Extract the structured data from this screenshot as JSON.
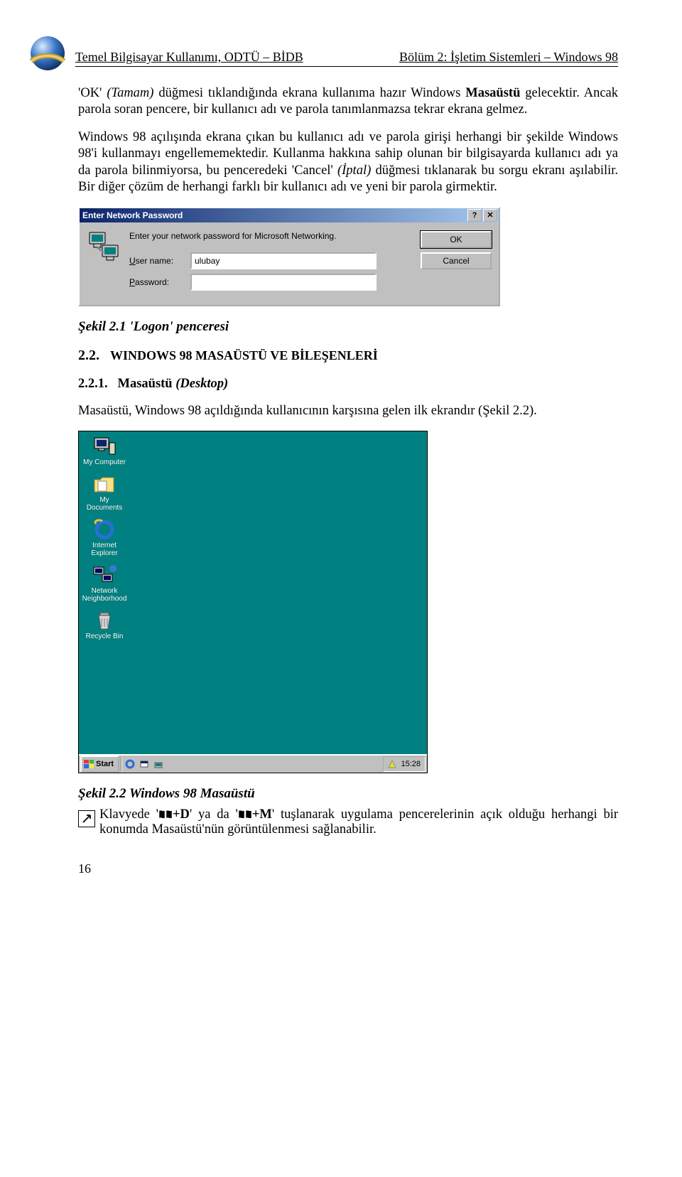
{
  "header": {
    "left": "Temel Bilgisayar Kullanımı, ODTÜ – BİDB",
    "right": "Bölüm 2: İşletim Sistemleri – Windows 98"
  },
  "para1_pre": "'OK' ",
  "para1_tamam": "(Tamam)",
  "para1_mid": " düğmesi tıklandığında ekrana kullanıma hazır Windows ",
  "para1_masaustu": "Masaüstü",
  "para1_post": " gelecektir. Ancak parola soran pencere, bir kullanıcı adı ve parola tanımlanmazsa tekrar ekrana gelmez.",
  "para2_a": "Windows 98 açılışında ekrana çıkan bu kullanıcı adı ve parola girişi herhangi bir şekilde Windows 98'i kullanmayı engellememektedir. Kullanma hakkına sahip olunan bir bilgisayarda kullanıcı adı ya da parola bilinmiyorsa, bu penceredeki 'Cancel' ",
  "para2_iptal": "(İptal)",
  "para2_b": " düğmesi tıklanarak bu sorgu ekranı aşılabilir. Bir diğer çözüm de herhangi farklı bir kullanıcı adı ve yeni bir parola girmektir.",
  "dialog": {
    "title": "Enter Network Password",
    "message": "Enter your network password for Microsoft Networking.",
    "userLabelU": "U",
    "userLabelRest": "ser name:",
    "userValue": "ulubay",
    "passLabelU": "P",
    "passLabelRest": "assword:",
    "passValue": "",
    "okLabel": "OK",
    "cancelLabel": "Cancel",
    "helpGlyph": "?",
    "closeGlyph": "✕"
  },
  "caption1": "Şekil 2.1 'Logon' penceresi",
  "section22_num": "2.2.",
  "section22_title": "WINDOWS 98 MASAÜSTÜ VE BİLEŞENLERİ",
  "section221_num": "2.2.1.",
  "section221_title": "Masaüstü ",
  "section221_title_it": "(Desktop)",
  "para3": "Masaüstü, Windows 98 açıldığında kullanıcının karşısına gelen ilk ekrandır (Şekil 2.2).",
  "desktop": {
    "icons": [
      {
        "name": "my-computer",
        "label": "My Computer"
      },
      {
        "name": "my-documents",
        "label": "My Documents"
      },
      {
        "name": "internet-explorer",
        "label": "Internet Explorer"
      },
      {
        "name": "network-neighborhood",
        "label": "Network Neighborhood"
      },
      {
        "name": "recycle-bin",
        "label": "Recycle Bin"
      }
    ],
    "startLabel": "Start",
    "clock": "15:28"
  },
  "caption2": "Şekil 2.2 Windows 98 Masaüstü",
  "tip_a": " Klavyede '",
  "tip_plusD": "+D",
  "tip_b": "' ya da '",
  "tip_plusM": "+M",
  "tip_c": "' tuşlanarak uygulama pencerelerinin açık olduğu herhangi bir konumda Masaüstü'nün görüntülenmesi sağlanabilir.",
  "pageNumber": "16"
}
